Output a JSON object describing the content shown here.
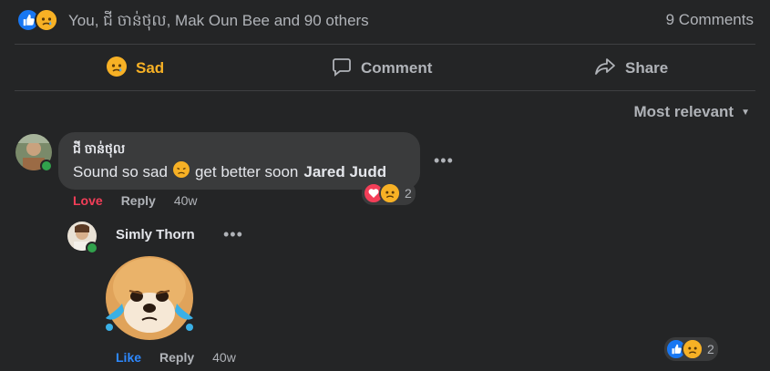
{
  "summary": {
    "reactors_text": "You, ជី ចាន់ថុល, Mak Oun Bee and 90 others",
    "comments_count": "9 Comments"
  },
  "actions": {
    "sad": "Sad",
    "comment": "Comment",
    "share": "Share"
  },
  "sort_label": "Most relevant",
  "comments": [
    {
      "author": "ជី ចាន់ថុល",
      "text": "Sound so sad",
      "text_after": "get better soon",
      "tag": "Jared Judd",
      "reaction_label": "Love",
      "reply_label": "Reply",
      "time": "40w",
      "reaction_count": "2"
    },
    {
      "author": "Simly Thorn",
      "reaction_label": "Like",
      "reply_label": "Reply",
      "time": "40w",
      "reaction_count": "2"
    }
  ],
  "colors": {
    "background": "#242526",
    "bubble": "#3a3b3c",
    "sad": "#f7b125",
    "like": "#1877f2",
    "love": "#f33e58"
  }
}
